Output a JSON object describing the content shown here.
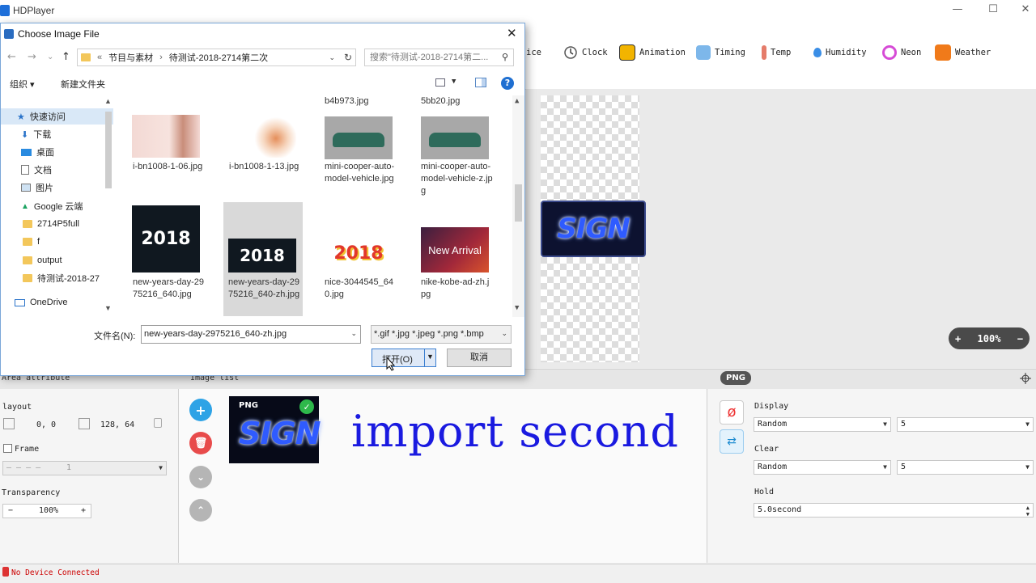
{
  "app": {
    "title": "HDPlayer"
  },
  "toolbar": {
    "partial_label": "ice",
    "items": [
      {
        "label": "Clock",
        "icon": "clock-icon"
      },
      {
        "label": "Animation",
        "icon": "animation-icon"
      },
      {
        "label": "Timing",
        "icon": "timing-icon"
      },
      {
        "label": "Temp",
        "icon": "thermometer-icon"
      },
      {
        "label": "Humidity",
        "icon": "humidity-icon"
      },
      {
        "label": "Neon",
        "icon": "neon-icon"
      },
      {
        "label": "Weather",
        "icon": "weather-icon"
      }
    ]
  },
  "preview": {
    "sign_text": "SIGN",
    "zoom": "100%"
  },
  "sections": {
    "area": "Area attribute",
    "images": "Image list",
    "format_tag": "PNG"
  },
  "area": {
    "layout_label": "layout",
    "position": "0, 0",
    "size": "128, 64",
    "frame_label": "Frame",
    "frame_value": "1",
    "frame_pattern": "— — — —",
    "transparency_label": "Transparency",
    "transparency_value": "100%"
  },
  "image_list": {
    "thumb_tag": "PNG",
    "thumb_text": "SIGN",
    "overlay_text": "import second"
  },
  "effects": {
    "display_label": "Display",
    "display_mode": "Random",
    "display_speed": "5",
    "clear_label": "Clear",
    "clear_mode": "Random",
    "clear_speed": "5",
    "hold_label": "Hold",
    "hold_value": "5.0second"
  },
  "status": {
    "text": "No Device Connected"
  },
  "dialog": {
    "title": "Choose Image File",
    "path": [
      "«",
      "节目与素材",
      "›",
      "待测试-2018-2714第二次"
    ],
    "search_placeholder": "搜索\"待测试-2018-2714第二...",
    "organize": "组织 ▾",
    "new_folder": "新建文件夹",
    "nav": [
      {
        "label": "快速访问",
        "icon": "star-icon"
      },
      {
        "label": "下载",
        "icon": "download-icon"
      },
      {
        "label": "桌面",
        "icon": "desktop-icon"
      },
      {
        "label": "文档",
        "icon": "document-icon"
      },
      {
        "label": "图片",
        "icon": "picture-icon"
      },
      {
        "label": "Google 云端",
        "icon": "google-drive-icon"
      },
      {
        "label": "2714P5full",
        "icon": "folder-icon"
      },
      {
        "label": "f",
        "icon": "folder-icon"
      },
      {
        "label": "output",
        "icon": "folder-icon"
      },
      {
        "label": "待测试-2018-27",
        "icon": "folder-icon"
      },
      {
        "label": "OneDrive",
        "icon": "onedrive-icon"
      }
    ],
    "files": [
      {
        "name": "b4b973.jpg"
      },
      {
        "name": "5bb20.jpg"
      },
      {
        "name": "i-bn1008-1-06.jpg"
      },
      {
        "name": "i-bn1008-1-13.jpg"
      },
      {
        "name": "mini-cooper-auto-model-vehicle.jpg"
      },
      {
        "name": "mini-cooper-auto-model-vehicle-z.jpg"
      },
      {
        "name": "new-years-day-2975216_640.jpg"
      },
      {
        "name": "new-years-day-2975216_640-zh.jpg"
      },
      {
        "name": "nice-3044545_640.jpg"
      },
      {
        "name": "nike-kobe-ad-zh.jpg"
      }
    ],
    "thumb_texts": {
      "year": "2018",
      "nike": "New Arrival"
    },
    "filename_label": "文件名(N):",
    "filename_value": "new-years-day-2975216_640-zh.jpg",
    "filter": "*.gif *.jpg *.jpeg *.png *.bmp",
    "open_label": "打开(O)",
    "cancel_label": "取消"
  }
}
